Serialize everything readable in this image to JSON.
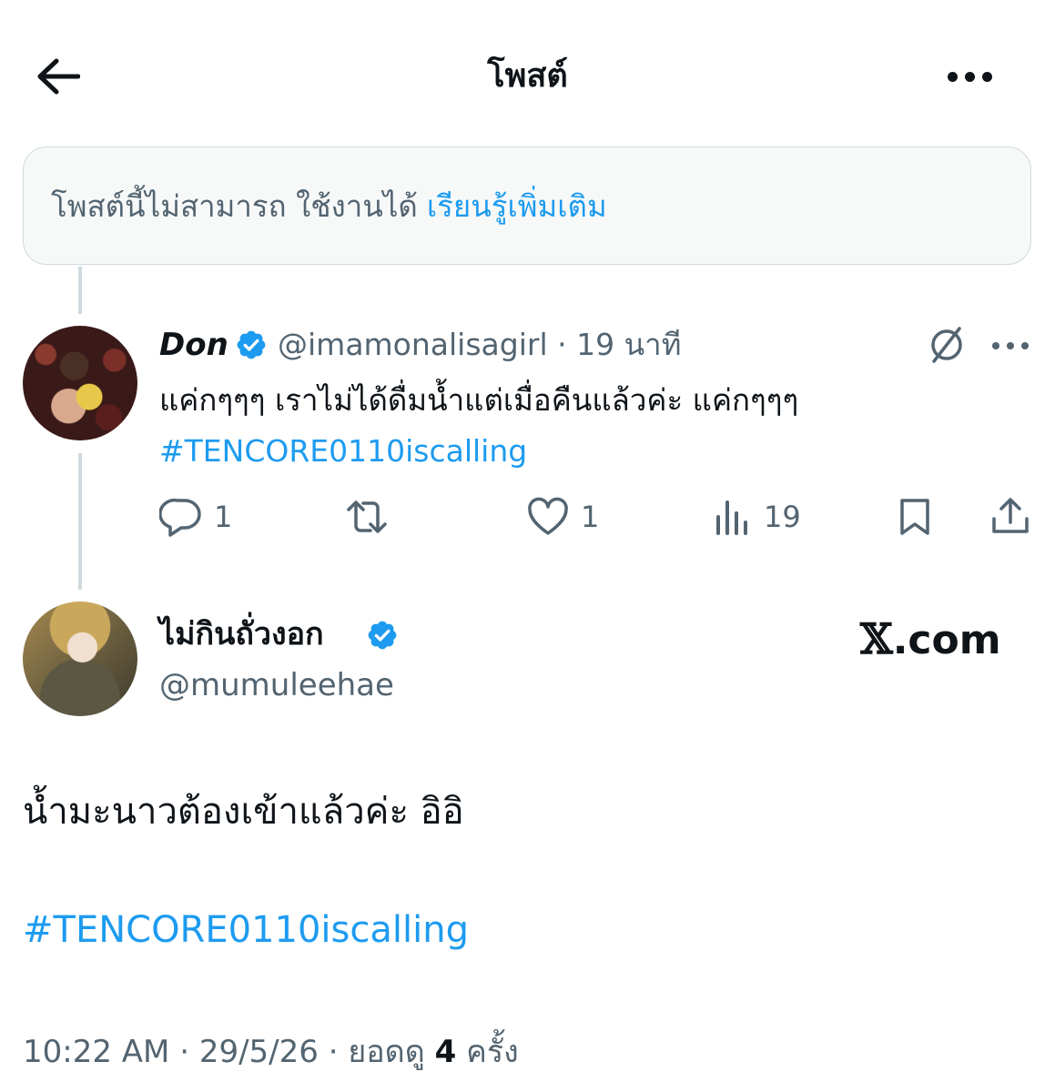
{
  "header": {
    "title": "โพสต์",
    "back_icon": "arrow-left-icon",
    "more_icon": "more-horizontal-icon"
  },
  "notice": {
    "text": "โพสต์นี้ไม่สามารถ ใช้งานได้",
    "link": "เรียนรู้เพิ่มเติม"
  },
  "reply": {
    "name": "Don",
    "handle": "@imamonalisagirl",
    "separator": "·",
    "time": "19 นาที",
    "text": "แค่กๆๆๆ เราไม่ได้ดื่มน้ำแต่เมื่อคืนแล้วค่ะ แค่กๆๆๆ",
    "hashtag": "#TENCORE0110iscalling",
    "actions": {
      "replies": "1",
      "retweets": "",
      "likes": "1",
      "views": "19"
    }
  },
  "post": {
    "name": "ไม่กินถั่วงอก",
    "handle": "@mumuleehae",
    "watermark_x": "𝕏",
    "watermark_text": ".com",
    "text": "น้ำมะนาวต้องเข้าแล้วค่ะ อิอิ",
    "hashtag": "#TENCORE0110iscalling",
    "time": "10:22 AM",
    "date": "29/5/26",
    "views_label": "ยอดดู",
    "views_count": "4",
    "views_unit": "ครั้ง",
    "separator": "·"
  },
  "colors": {
    "accent": "#1d9bf0",
    "text": "#0f1419",
    "secondary": "#536471",
    "border": "#cfd9de",
    "notice_bg": "#f7f9f9"
  }
}
